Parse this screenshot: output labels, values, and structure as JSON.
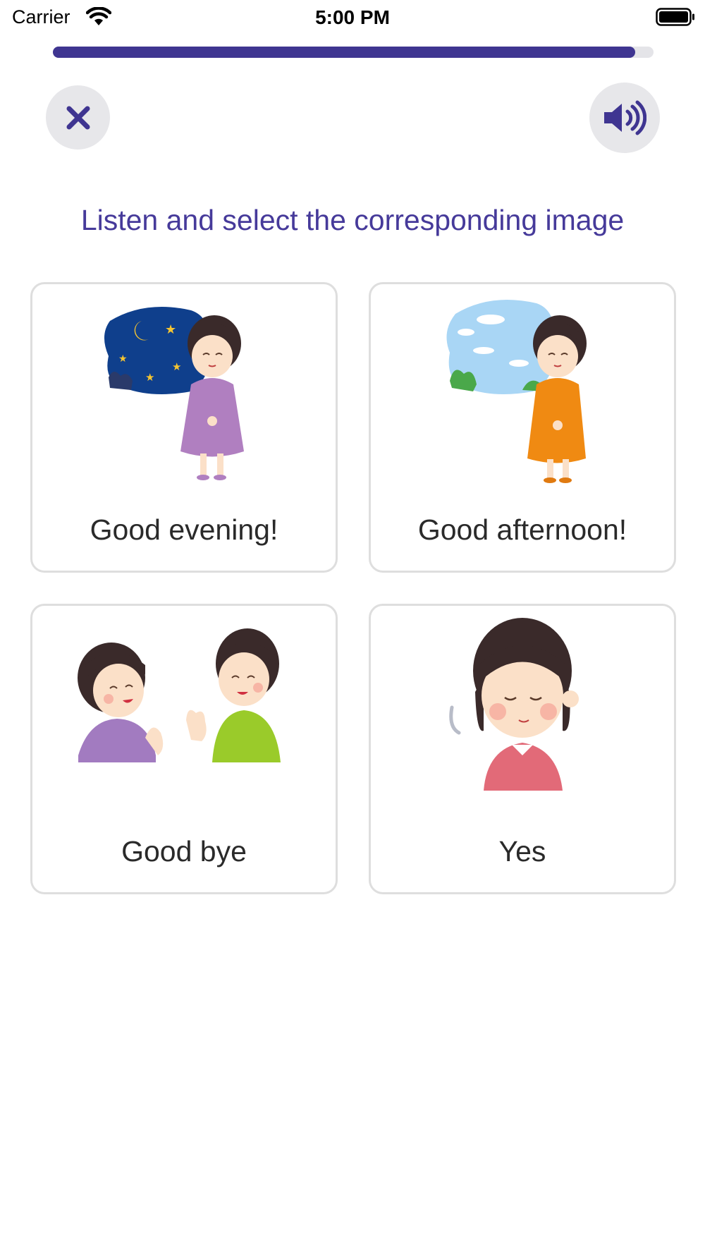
{
  "status_bar": {
    "carrier": "Carrier",
    "time": "5:00 PM"
  },
  "progress": {
    "fraction": 0.97,
    "color": "#3f3591"
  },
  "toolbar": {
    "close_icon": "close-icon",
    "sound_icon": "speaker-icon"
  },
  "prompt": "Listen and select the corresponding image",
  "options": [
    {
      "label": "Good evening!",
      "image": "woman-bowing-night-sky"
    },
    {
      "label": "Good afternoon!",
      "image": "woman-bowing-day-sky"
    },
    {
      "label": "Good bye",
      "image": "two-women-waving"
    },
    {
      "label": "Yes",
      "image": "woman-nodding"
    }
  ],
  "colors": {
    "accent": "#463a9a",
    "card_border": "#dedede",
    "button_bg": "#e7e7ea"
  }
}
